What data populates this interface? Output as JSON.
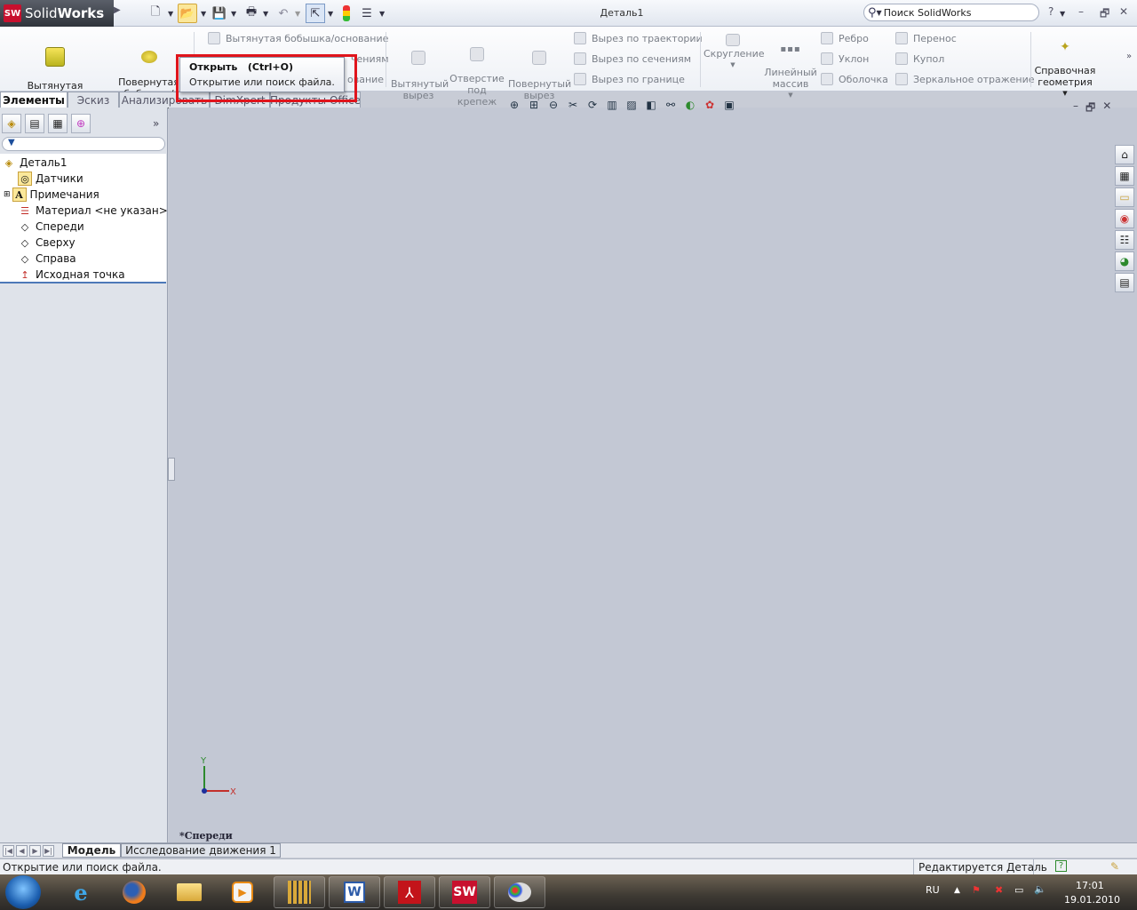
{
  "app": {
    "brand_solid": "Solid",
    "brand_works": "Works",
    "logo_text": "SW",
    "document_title": "Деталь1"
  },
  "search": {
    "placeholder": "Поиск SolidWorks"
  },
  "commands": {
    "extruded_boss": "Вытянутая\nбобышка/основание",
    "revolved_boss": "Повернутая\nбобышка/основание",
    "swept_boss": "Вытянутая бобышка/основание",
    "lofted_boss_partial": "чениям",
    "boundary_boss_partial": "ование",
    "extruded_cut": "Вытянутый\nвырез",
    "hole_wizard": "Отверстие\nпод\nкрепеж",
    "revolved_cut": "Повернутый\nвырез",
    "swept_cut": "Вырез по траектории",
    "lofted_cut": "Вырез по сечениям",
    "boundary_cut": "Вырез по границе",
    "fillet": "Скругление",
    "linear_pattern": "Линейный\nмассив",
    "rib": "Ребро",
    "draft": "Уклон",
    "shell": "Оболочка",
    "wrap": "Перенос",
    "dome": "Купол",
    "mirror": "Зеркальное отражение",
    "ref_geometry": "Справочная\nгеометрия"
  },
  "tooltip": {
    "title": "Открыть",
    "shortcut": "(Ctrl+O)",
    "description": "Открытие или поиск файла."
  },
  "tabs": [
    "Элементы",
    "Эскиз",
    "Анализировать",
    "DimXpert",
    "Продукты Office"
  ],
  "tree": {
    "root": "Деталь1",
    "items": [
      "Датчики",
      "Примечания",
      "Материал <не указан>",
      "Спереди",
      "Сверху",
      "Справа",
      "Исходная точка"
    ]
  },
  "viewport": {
    "view_label": "*Спереди",
    "axis_y": "Y",
    "axis_x": "X"
  },
  "bottom_tabs": [
    "Модель",
    "Исследование движения 1"
  ],
  "status": {
    "left": "Открытие или поиск файла.",
    "right": "Редактируется Деталь"
  },
  "taskbar": {
    "lang": "RU",
    "time": "17:01",
    "date": "19.01.2010"
  },
  "colors": {
    "highlight": "#e0141c",
    "logo_red": "#c8102e"
  }
}
